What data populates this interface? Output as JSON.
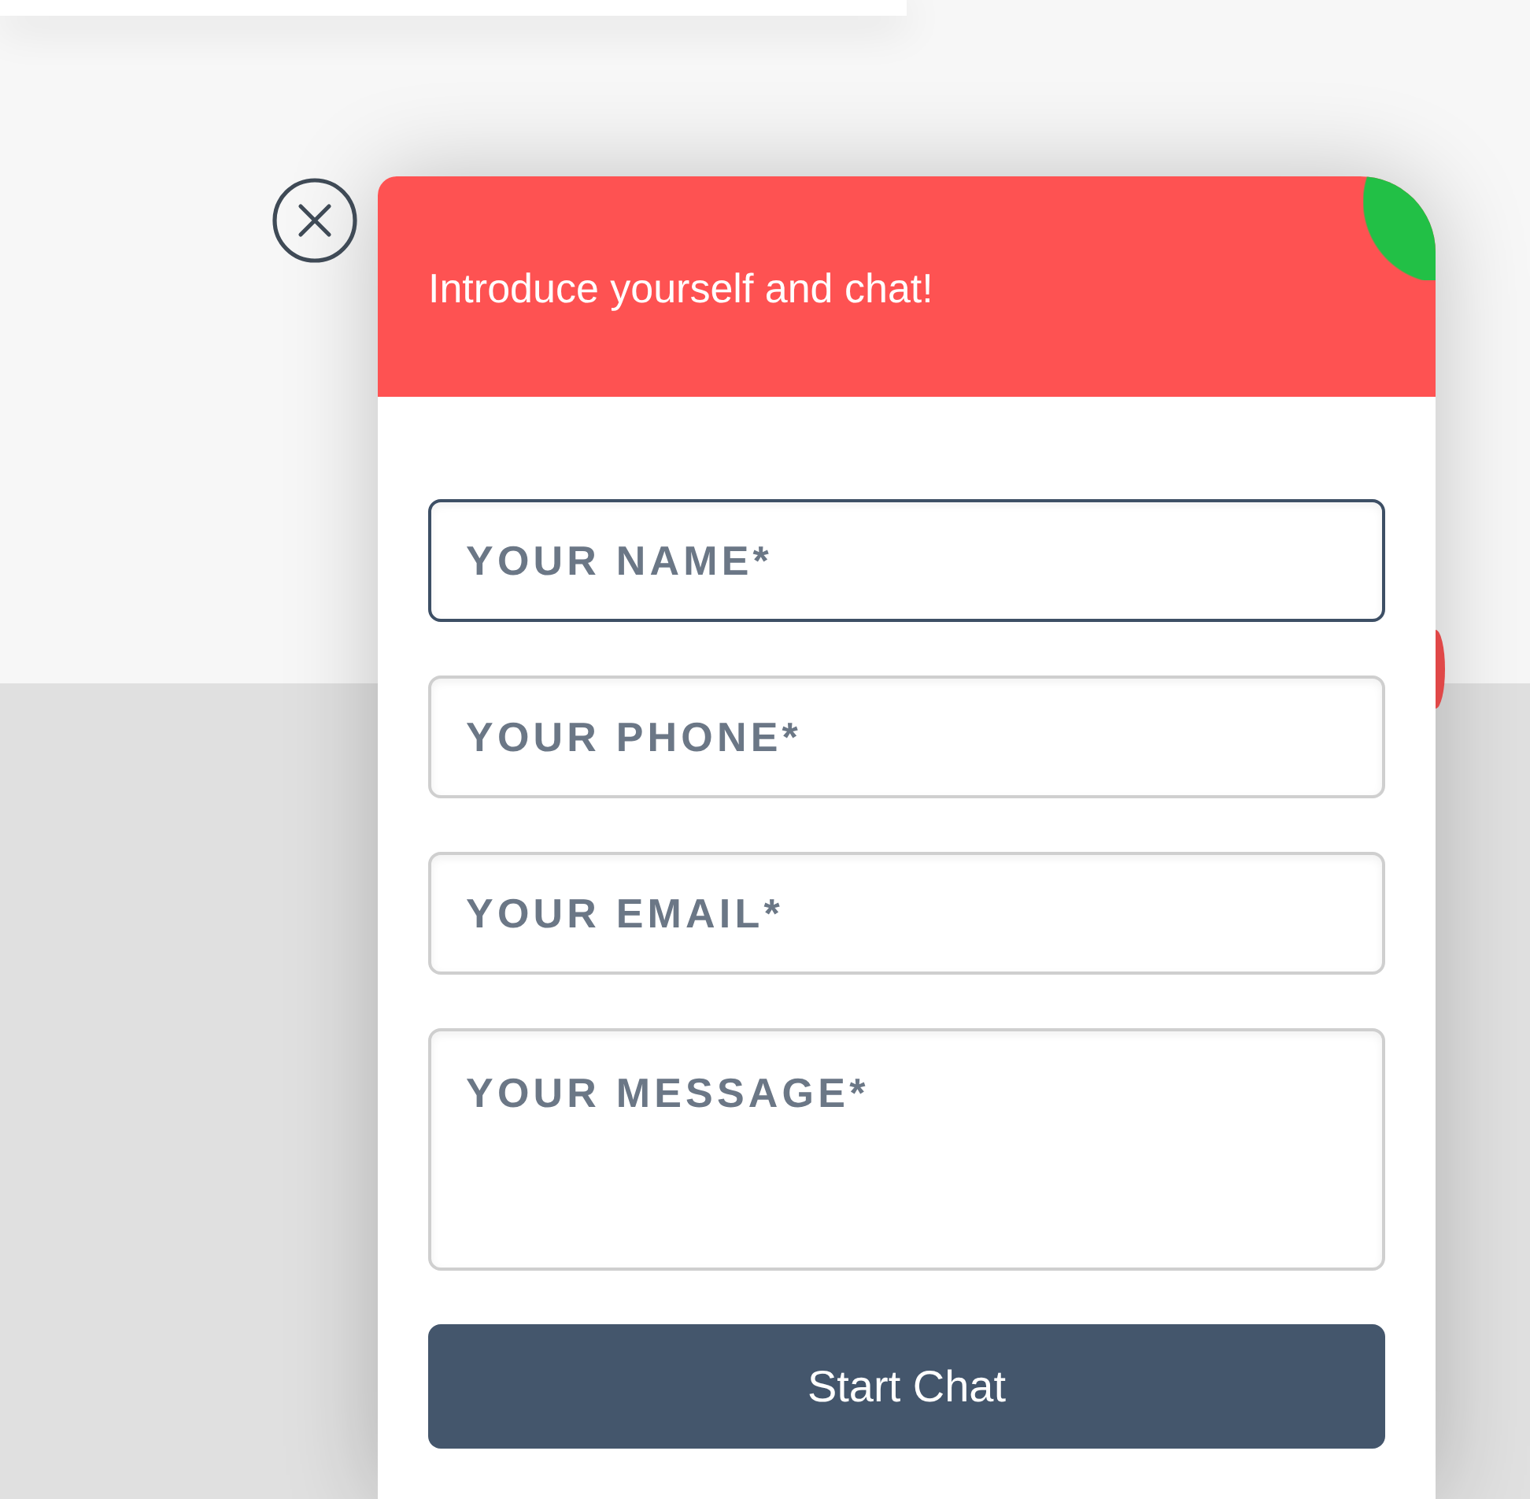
{
  "chat": {
    "title": "Introduce yourself and chat!",
    "online": true
  },
  "fields": [
    {
      "kind": "input",
      "placeholder": "YOUR NAME*",
      "focused": true
    },
    {
      "kind": "input",
      "placeholder": "YOUR PHONE*",
      "focused": false
    },
    {
      "kind": "input",
      "placeholder": "YOUR EMAIL*",
      "focused": false
    },
    {
      "kind": "textarea",
      "placeholder": "YOUR MESSAGE*",
      "focused": false
    }
  ],
  "button": "Start Chat"
}
